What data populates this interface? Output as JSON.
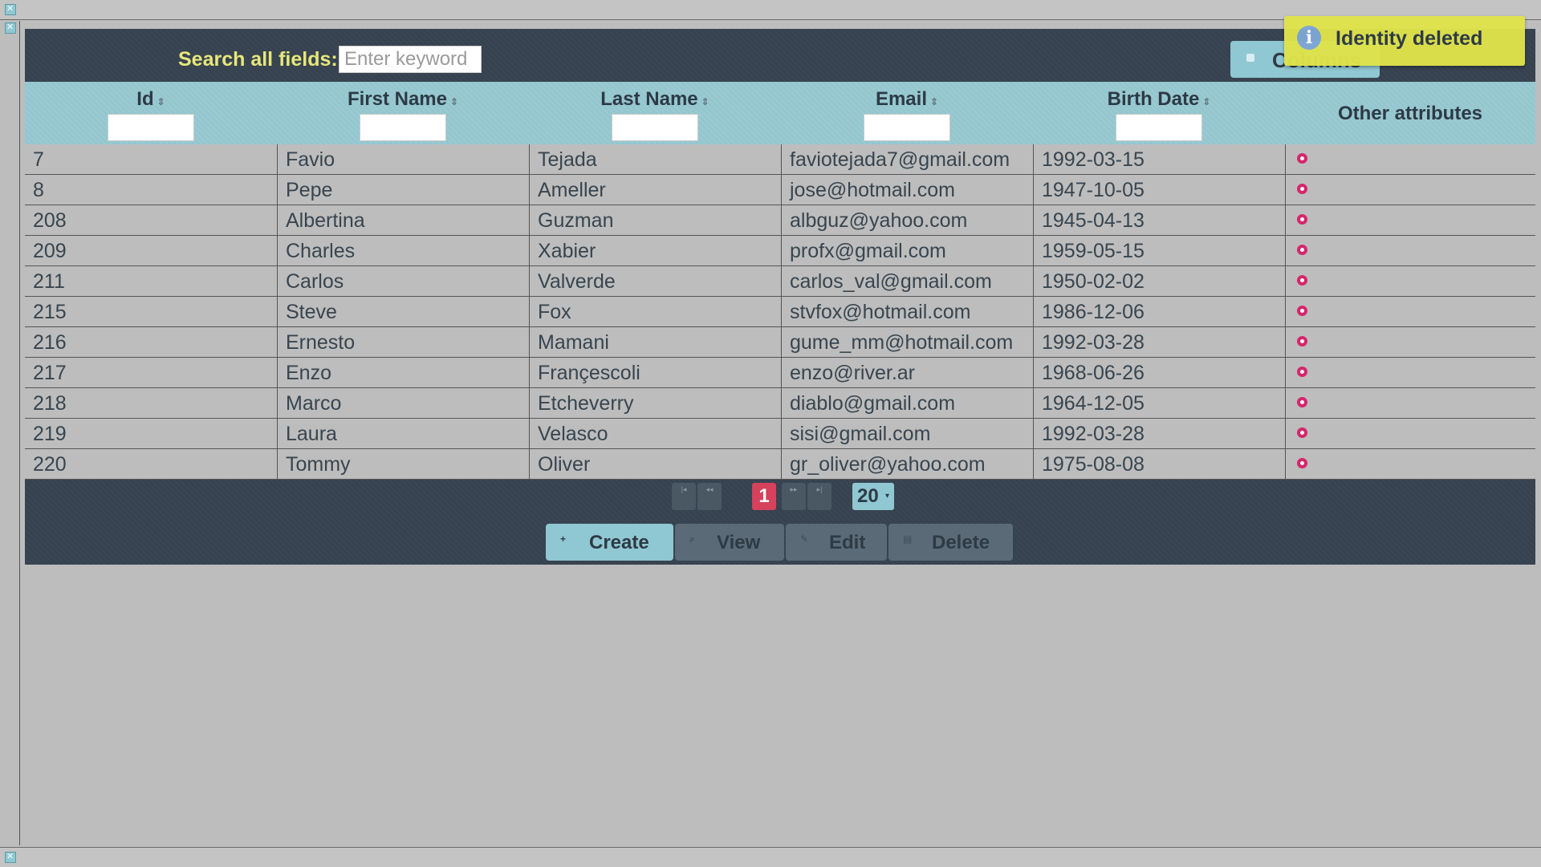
{
  "search": {
    "label": "Search all fields:",
    "placeholder": "Enter keyword",
    "value": ""
  },
  "columns_button": {
    "label": "Columns"
  },
  "table": {
    "headers": [
      {
        "label": "Id"
      },
      {
        "label": "First Name"
      },
      {
        "label": "Last Name"
      },
      {
        "label": "Email"
      },
      {
        "label": "Birth Date"
      },
      {
        "label": "Other attributes"
      }
    ],
    "rows": [
      [
        "7",
        "Favio",
        "Tejada",
        "faviotejada7@gmail.com",
        "1992-03-15"
      ],
      [
        "8",
        "Pepe",
        "Ameller",
        "jose@hotmail.com",
        "1947-10-05"
      ],
      [
        "208",
        "Albertina",
        "Guzman",
        "albguz@yahoo.com",
        "1945-04-13"
      ],
      [
        "209",
        "Charles",
        "Xabier",
        "profx@gmail.com",
        "1959-05-15"
      ],
      [
        "211",
        "Carlos",
        "Valverde",
        "carlos_val@gmail.com",
        "1950-02-02"
      ],
      [
        "215",
        "Steve",
        "Fox",
        "stvfox@hotmail.com",
        "1986-12-06"
      ],
      [
        "216",
        "Ernesto",
        "Mamani",
        "gume_mm@hotmail.com",
        "1992-03-28"
      ],
      [
        "217",
        "Enzo",
        "Françescoli",
        "enzo@river.ar",
        "1968-06-26"
      ],
      [
        "218",
        "Marco",
        "Etcheverry",
        "diablo@gmail.com",
        "1964-12-05"
      ],
      [
        "219",
        "Laura",
        "Velasco",
        "sisi@gmail.com",
        "1992-03-28"
      ],
      [
        "220",
        "Tommy",
        "Oliver",
        "gr_oliver@yahoo.com",
        "1975-08-08"
      ]
    ]
  },
  "pagination": {
    "current_page": "1",
    "rows_per_page": "20"
  },
  "actions": {
    "create": "Create",
    "view": "View",
    "edit": "Edit",
    "delete": "Delete"
  },
  "toast": {
    "message": "Identity deleted",
    "icon": "info-icon"
  },
  "colors": {
    "panel": "#36424f",
    "header": "#93c6ce",
    "accent": "#8fc7d2",
    "page_current": "#d6415c",
    "toast": "#e0e44a",
    "search_label": "#e7e77a",
    "row_dot": "#d6266b"
  }
}
